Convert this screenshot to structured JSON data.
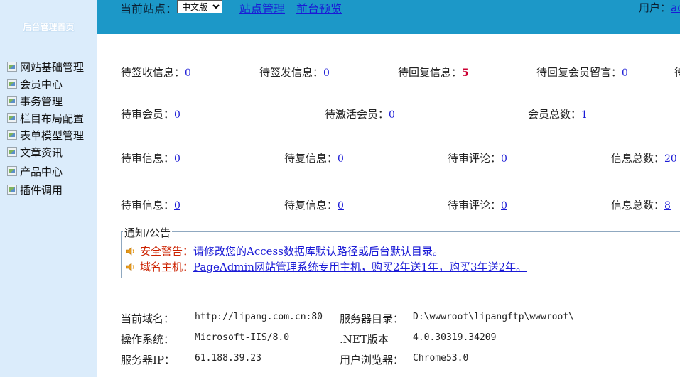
{
  "sidebar": {
    "home_link": "后台管理首页",
    "items": [
      {
        "label": "网站基础管理"
      },
      {
        "label": "会员中心"
      },
      {
        "label": "事务管理"
      },
      {
        "label": "栏目布局配置"
      },
      {
        "label": "表单模型管理"
      },
      {
        "label": "文章资讯"
      },
      {
        "label": "产品中心"
      },
      {
        "label": "插件调用"
      }
    ]
  },
  "topbar": {
    "current_site_label": "当前站点：",
    "site_select_value": "中文版",
    "site_manage_link": "站点管理",
    "preview_link": "前台预览",
    "user_label": "用户：",
    "user_name": "ad"
  },
  "stats": {
    "row1": [
      {
        "label": "待签收信息：",
        "value": "0"
      },
      {
        "label": "待签发信息：",
        "value": "0"
      },
      {
        "label": "待回复信息：",
        "value": "5"
      },
      {
        "label": "待回复会员留言：",
        "value": "0"
      },
      {
        "label": "待",
        "value": ""
      }
    ],
    "row2": [
      {
        "label": "待审会员：",
        "value": "0"
      },
      {
        "label": "待激活会员：",
        "value": "0"
      },
      {
        "label": "会员总数：",
        "value": "1"
      }
    ],
    "row3": [
      {
        "label": "待审信息：",
        "value": "0"
      },
      {
        "label": "待复信息：",
        "value": "0"
      },
      {
        "label": "待审评论：",
        "value": "0"
      },
      {
        "label": "信息总数：",
        "value": "20"
      }
    ],
    "row4": [
      {
        "label": "待审信息：",
        "value": "0"
      },
      {
        "label": "待复信息：",
        "value": "0"
      },
      {
        "label": "待审评论：",
        "value": "0"
      },
      {
        "label": "信息总数：",
        "value": "8"
      }
    ]
  },
  "notice": {
    "title": "通知/公告",
    "items": [
      {
        "tag": "安全警告：",
        "text": "请修改您的Access数据库默认路径或后台默认目录。"
      },
      {
        "tag": "域名主机：",
        "text": "PageAdmin网站管理系统专用主机，购买2年送1年，购买3年送2年。"
      }
    ]
  },
  "server_info": {
    "domain_label": "当前域名：",
    "domain_value": "http://lipang.com.cn:80",
    "dir_label": "服务器目录：",
    "dir_value": "D:\\wwwroot\\lipangftp\\wwwroot\\",
    "os_label": "操作系统：",
    "os_value": "Microsoft-IIS/8.0",
    "net_label": ".NET版本",
    "net_value": "4.0.30319.34209",
    "ip_label": "服务器IP：",
    "ip_value": "61.188.39.23",
    "browser_label": "用户浏览器：",
    "browser_value": "Chrome53.0"
  },
  "colors": {
    "topbar": "#1c98c8",
    "sidebar": "#dbecfb",
    "link": "#1a1ad6",
    "alert": "#cc2200"
  }
}
